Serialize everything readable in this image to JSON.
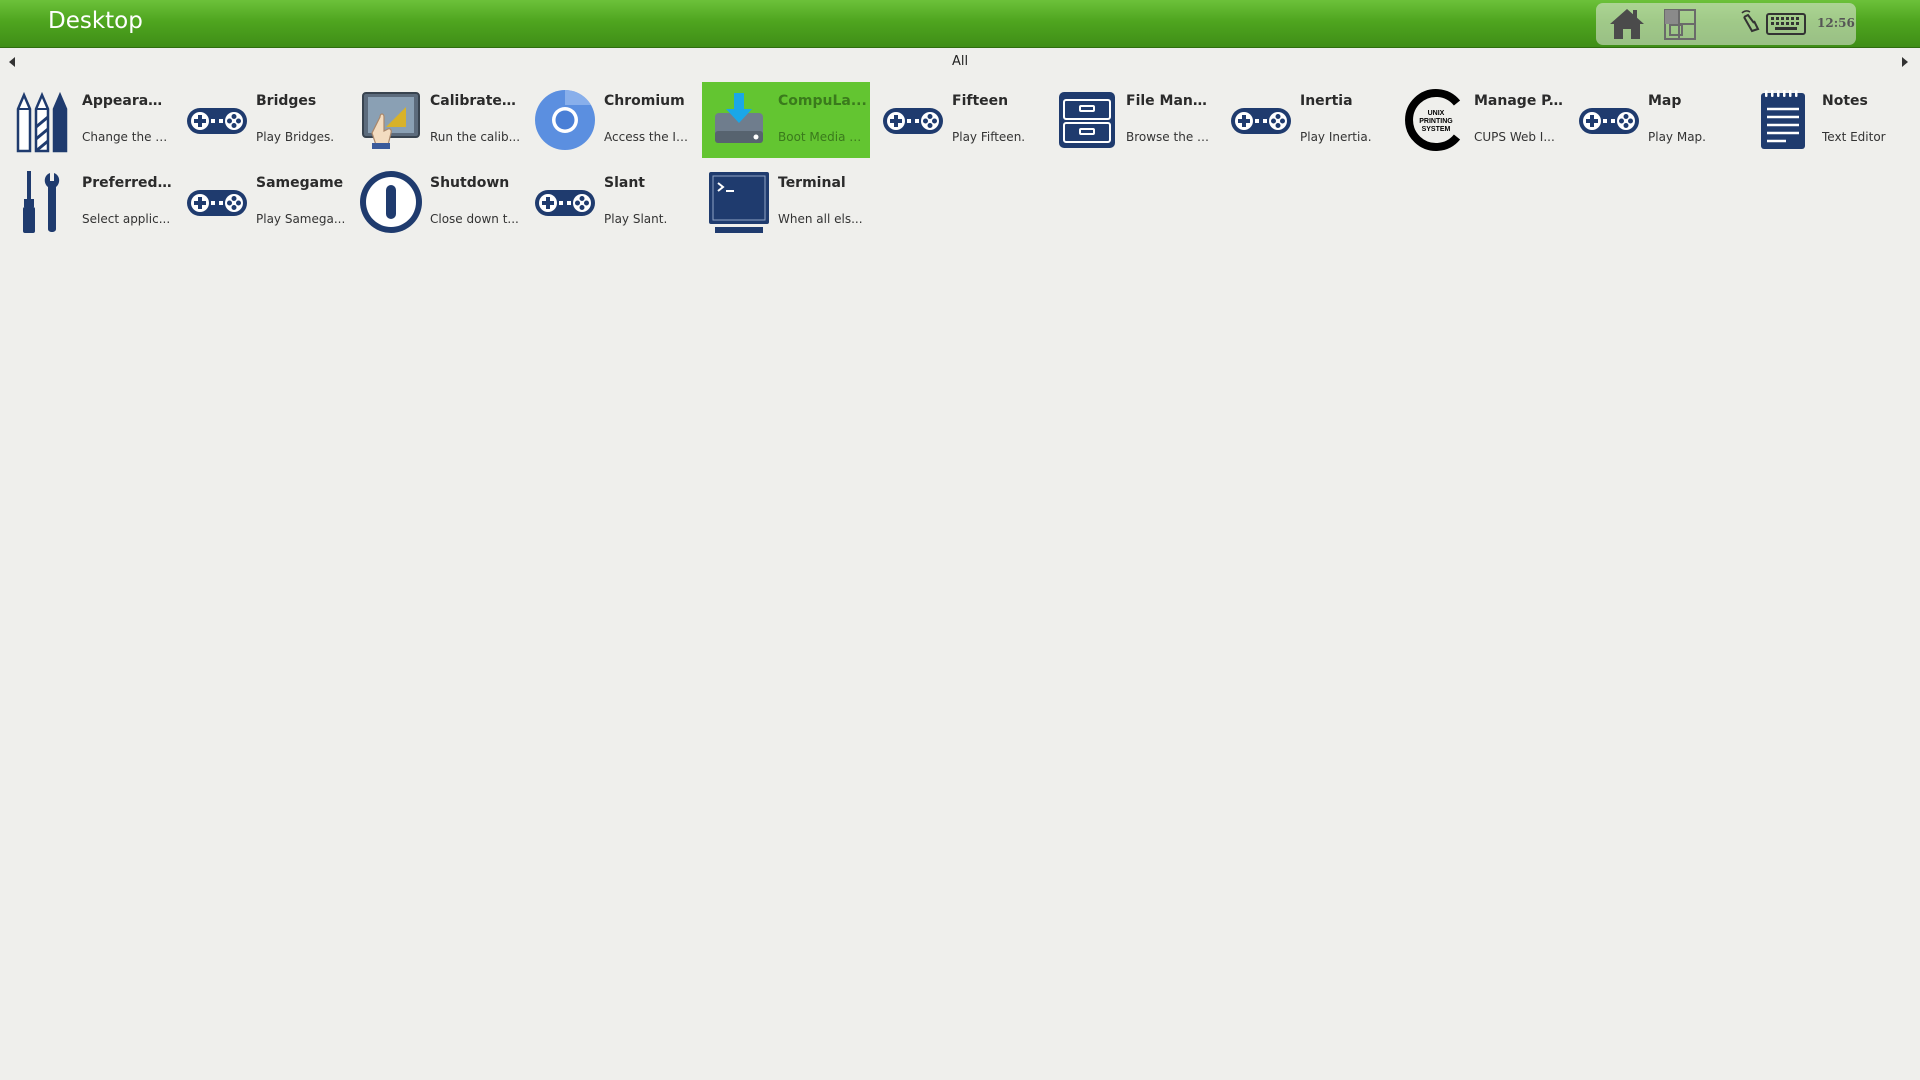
{
  "window": {
    "title": "Desktop"
  },
  "tray": {
    "clock": "12:56"
  },
  "category": {
    "label": "All"
  },
  "apps": [
    {
      "name": "Appearance",
      "desc": "Change the a..."
    },
    {
      "name": "Bridges",
      "desc": "Play Bridges."
    },
    {
      "name": "Calibrate ...",
      "desc": "Run the calib..."
    },
    {
      "name": "Chromium",
      "desc": "Access the In..."
    },
    {
      "name": "CompuLa...",
      "desc": "Boot Media C...",
      "selected": true
    },
    {
      "name": "Fifteen",
      "desc": "Play Fifteen."
    },
    {
      "name": "File Mana...",
      "desc": "Browse the fil..."
    },
    {
      "name": "Inertia",
      "desc": "Play Inertia."
    },
    {
      "name": "Manage P...",
      "desc": "CUPS Web I..."
    },
    {
      "name": "Map",
      "desc": "Play Map."
    },
    {
      "name": "Notes",
      "desc": "Text Editor"
    },
    {
      "name": "Preferred ...",
      "desc": "Select applic..."
    },
    {
      "name": "Samegame",
      "desc": "Play Samega..."
    },
    {
      "name": "Shutdown",
      "desc": "Close down t..."
    },
    {
      "name": "Slant",
      "desc": "Play Slant."
    },
    {
      "name": "Terminal",
      "desc": "When all els..."
    }
  ],
  "cups_logo": {
    "lines": [
      "UNIX",
      "PRINTING",
      "SYSTEM"
    ]
  },
  "colors": {
    "accent": "#63c531",
    "icon": "#1f3b6e",
    "topbar": "#4fa51f"
  }
}
